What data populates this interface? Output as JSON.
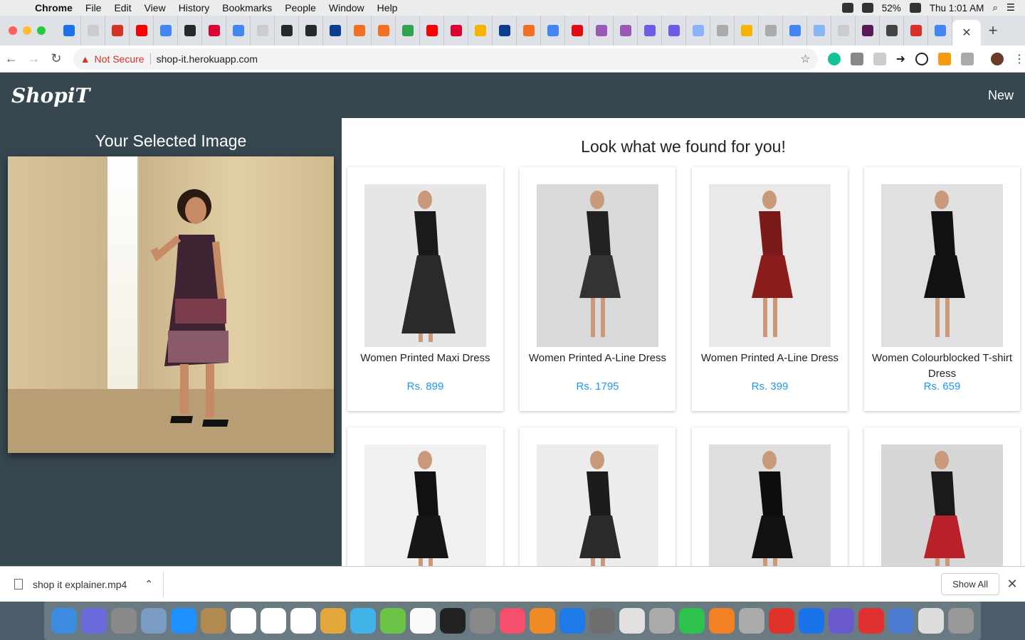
{
  "menubar": {
    "app": "Chrome",
    "items": [
      "File",
      "Edit",
      "View",
      "History",
      "Bookmarks",
      "People",
      "Window",
      "Help"
    ],
    "battery": "52%",
    "clock": "Thu 1:01 AM"
  },
  "browser": {
    "security_label": "Not Secure",
    "url": "shop-it.herokuapp.com",
    "new_tab": "+",
    "close_tab": "✕"
  },
  "app": {
    "logo": "ShopiT",
    "new_link": "New"
  },
  "sidebar": {
    "title": "Your Selected Image"
  },
  "main": {
    "title": "Look what we found for you!",
    "products": [
      {
        "name": "Women Printed Maxi Dress",
        "price": "Rs. 899"
      },
      {
        "name": "Women Printed A-Line Dress",
        "price": "Rs. 1795"
      },
      {
        "name": "Women Printed A-Line Dress",
        "price": "Rs. 399"
      },
      {
        "name": "Women Colourblocked T-shirt Dress",
        "price": "Rs. 659"
      },
      {
        "name": "",
        "price": ""
      },
      {
        "name": "",
        "price": ""
      },
      {
        "name": "",
        "price": ""
      },
      {
        "name": "",
        "price": ""
      }
    ]
  },
  "downloads": {
    "file": "shop it explainer.mp4",
    "show_all": "Show All"
  },
  "colors": {
    "appbar": "#37474f",
    "price": "#2196f3"
  }
}
